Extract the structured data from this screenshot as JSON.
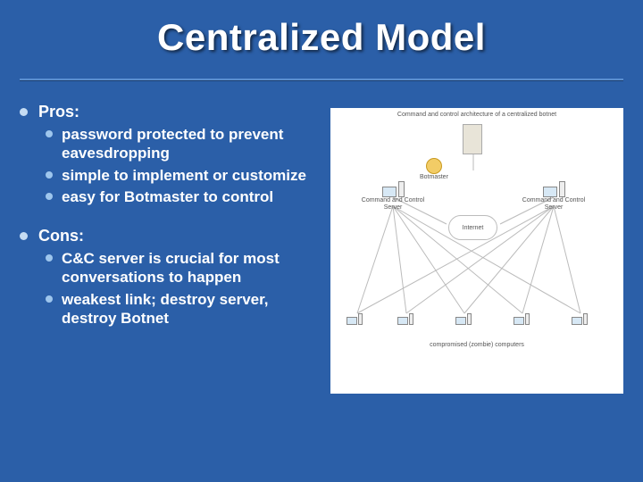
{
  "title": "Centralized Model",
  "pros": {
    "label": "Pros:",
    "items": [
      "password protected to prevent eavesdropping",
      "simple to implement or customize",
      "easy for Botmaster to control"
    ]
  },
  "cons": {
    "label": "Cons:",
    "items": [
      "C&C server is crucial for most conversations to happen",
      "weakest link; destroy server, destroy Botnet"
    ]
  },
  "diagram": {
    "header": "Command and control architecture of a centralized botnet",
    "botmaster": "Botmaster",
    "cnc": "Command and Control Server",
    "internet": "Internet",
    "footer": "compromised (zombie) computers"
  }
}
